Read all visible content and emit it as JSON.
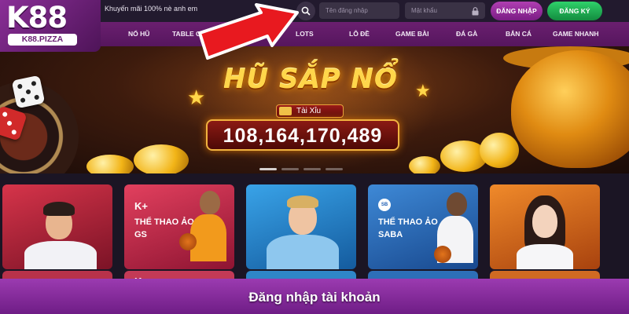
{
  "logo": {
    "brand": "K88",
    "domain": "K88.PIZZA"
  },
  "header": {
    "promo_text": "Khuyến mãi 100% nè anh em",
    "username_placeholder": "Tên đăng nhập",
    "password_placeholder": "Mật khẩu",
    "login_label": "ĐĂNG NHẬP",
    "register_label": "ĐĂNG KÝ"
  },
  "nav": {
    "items": [
      {
        "label": "NỔ HŨ"
      },
      {
        "label": "TABLE GA"
      },
      {
        "label": "LOTS"
      },
      {
        "label": "LÔ ĐỀ"
      },
      {
        "label": "GAME BÀI"
      },
      {
        "label": "ĐÁ GÀ"
      },
      {
        "label": "BẮN CÁ"
      },
      {
        "label": "GAME NHANH"
      }
    ]
  },
  "banner": {
    "title": "HŨ SẮP NỔ",
    "game_name": "Tài Xỉu",
    "jackpot_amount": "108,164,170,489"
  },
  "cards": [
    {
      "logo": "",
      "title": "",
      "subtitle": ""
    },
    {
      "logo": "K+",
      "title": "THỂ THAO ẢO",
      "subtitle": "GS"
    },
    {
      "logo": "",
      "title": "",
      "subtitle": ""
    },
    {
      "logo": "",
      "title": "THỂ THAO ẢO",
      "subtitle": "SABA"
    },
    {
      "logo": "",
      "title": "",
      "subtitle": ""
    }
  ],
  "row2_logo": "K+",
  "caption": "Đăng nhập tài khoản",
  "colors": {
    "nav_bg": "#6a1f6f",
    "login_button": "#9b2fa0",
    "register_button": "#22b556",
    "caption_bar": "#8a2fa2",
    "jackpot_text": "#ffd64a"
  }
}
